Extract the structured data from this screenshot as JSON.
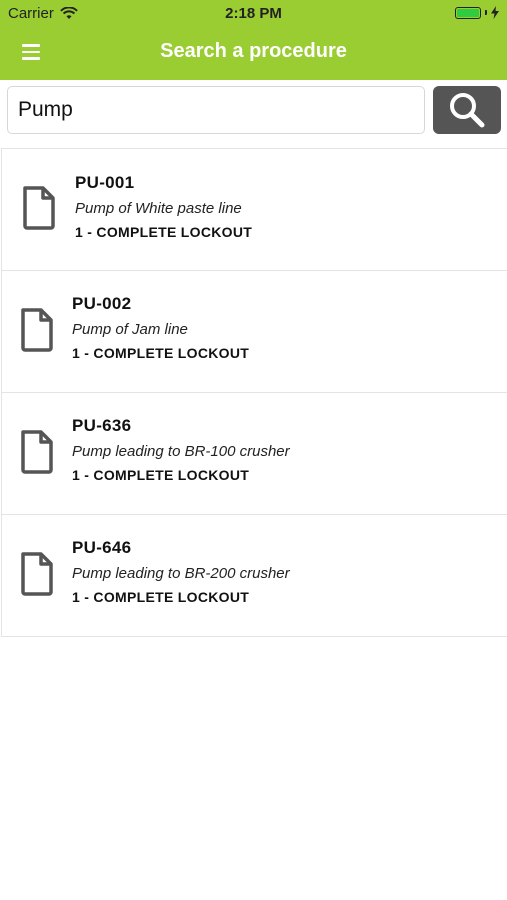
{
  "status_bar": {
    "carrier": "Carrier",
    "time": "2:18 PM"
  },
  "header": {
    "title": "Search a procedure",
    "menu_icon": "hamburger-menu-icon"
  },
  "search": {
    "value": "Pump",
    "button_icon": "magnifier-icon"
  },
  "results": [
    {
      "code": "PU-001",
      "description": "Pump of White paste line",
      "level": "1 - COMPLETE LOCKOUT"
    },
    {
      "code": "PU-002",
      "description": "Pump of Jam line",
      "level": "1 - COMPLETE LOCKOUT"
    },
    {
      "code": "PU-636",
      "description": "Pump leading to BR-100 crusher",
      "level": "1 - COMPLETE LOCKOUT"
    },
    {
      "code": "PU-646",
      "description": "Pump leading to BR-200 crusher",
      "level": "1 - COMPLETE LOCKOUT"
    }
  ],
  "colors": {
    "header_green": "#9acd32",
    "search_button": "#555555",
    "battery_green": "#2ecc40"
  }
}
